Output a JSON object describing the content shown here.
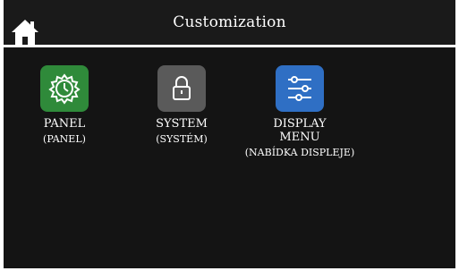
{
  "header": {
    "title": "Customization",
    "home_icon": "home-icon"
  },
  "tiles": [
    {
      "label": "PANEL",
      "sublabel": "(PANEL)",
      "icon": "gear-icon",
      "color": "#2f8a3a"
    },
    {
      "label": "SYSTEM",
      "sublabel": "(SYSTÉM)",
      "icon": "lock-icon",
      "color": "#5a5a5a"
    },
    {
      "label": "DISPLAY\nMENU",
      "sublabel": "(NABÍDKA DISPLEJE)",
      "icon": "sliders-icon",
      "color": "#2f6fc4"
    }
  ],
  "colors": {
    "header_bg": "#1a1a1a",
    "content_bg": "#141414",
    "text": "#ffffff"
  }
}
